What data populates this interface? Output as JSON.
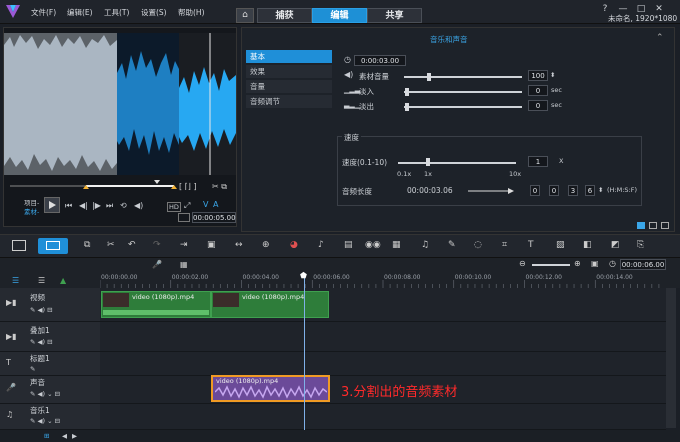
{
  "menu": [
    "文件(F)",
    "编辑(E)",
    "工具(T)",
    "设置(S)",
    "帮助(H)"
  ],
  "tabs": [
    "捕获",
    "编辑",
    "共享"
  ],
  "project_info": "未命名, 1920*1080",
  "preview": {
    "mode_labels": [
      "项目-",
      "素材-"
    ],
    "timecode": "00:00:05.00"
  },
  "options": {
    "title": "音乐和声音",
    "nav": [
      "基本",
      "效果",
      "音量",
      "音频调节"
    ],
    "duration": "0:00:03.00",
    "clip_volume_label": "素材音量",
    "clip_volume_value": "100",
    "fade_in_label": "淡入",
    "fade_in_value": "0",
    "fade_out_label": "淡出",
    "fade_out_value": "0",
    "sec_unit": "sec",
    "speed_section": "速度",
    "speed_label": "速度(0.1-10)",
    "speed_value": "1",
    "speed_unit": "X",
    "speed_marks": [
      "0.1x",
      "1x",
      "10x"
    ],
    "audio_length_label": "音频长度",
    "audio_length_value": "00:00:03.06",
    "length_fields": [
      "0",
      "0",
      "3",
      "6"
    ],
    "length_format": "(H:M:S:F)"
  },
  "timeline": {
    "timecode": "00:00:06.00",
    "ruler": [
      "00:00:00.00",
      "00:00:02.00",
      "00:00:04.00",
      "00:00:06.00",
      "00:00:08.00",
      "00:00:10.00",
      "00:00:12.00",
      "00:00:14.00"
    ],
    "tracks": [
      "视频",
      "叠加1",
      "标题1",
      "声音",
      "音乐1"
    ],
    "video_clips": [
      "video (1080p).mp4",
      "video (1080p).mp4"
    ],
    "audio_clip": "video (1080p).mp4",
    "annotation": "3.分割出的音频素材"
  },
  "colors": {
    "accent": "#1e90d6",
    "video_clip": "#2e7d3a",
    "audio_clip": "#6b4a99",
    "audio_border": "#f09a24",
    "annotation": "#ff2a2a"
  }
}
